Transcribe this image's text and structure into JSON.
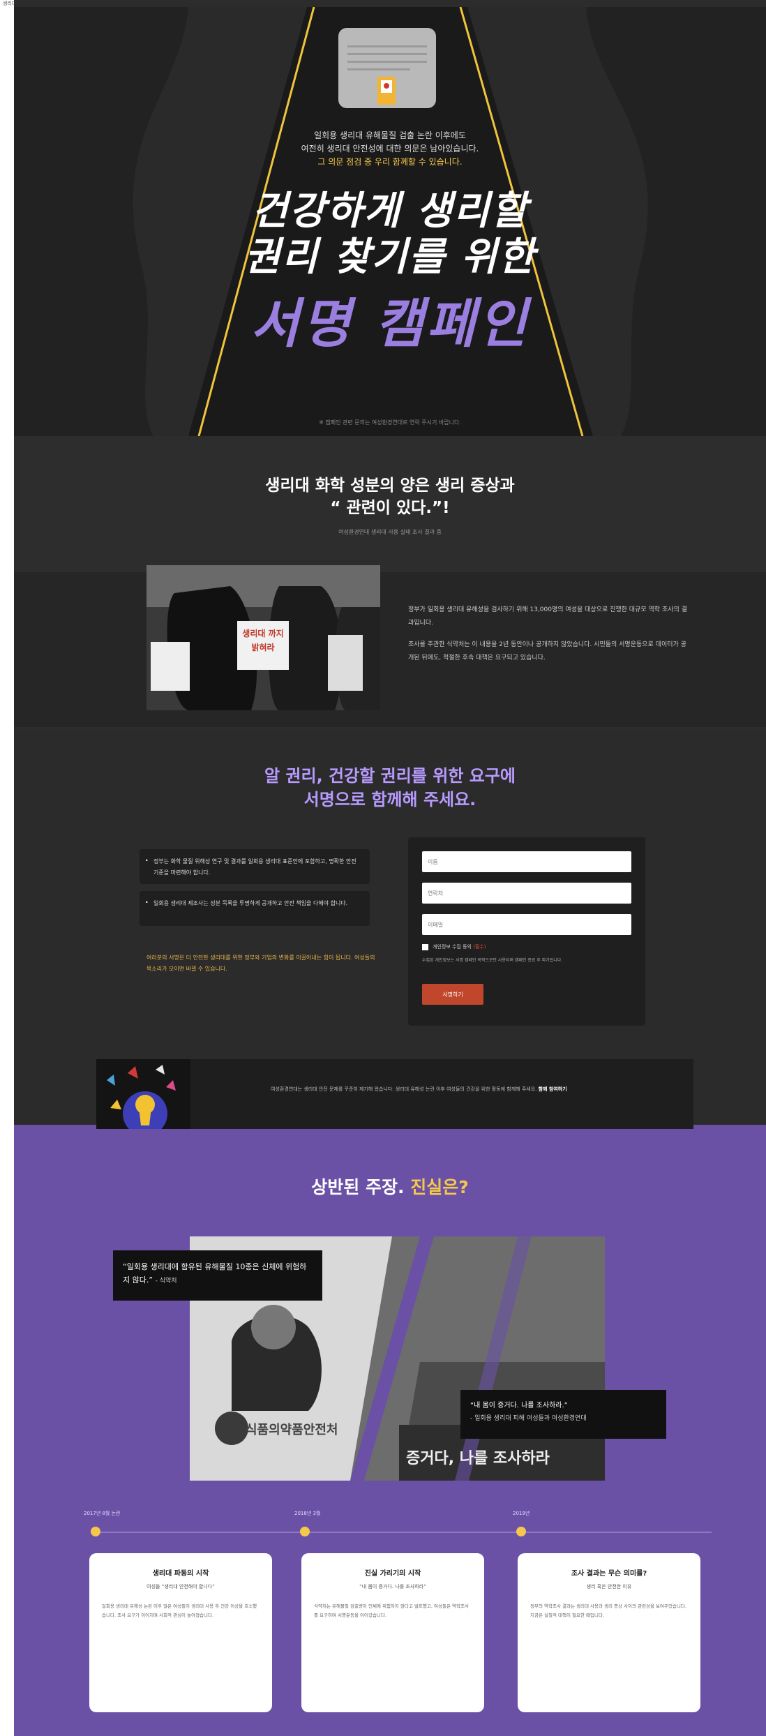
{
  "topbar": {
    "text": "생리대 화학물질 서명 캠페인"
  },
  "hero": {
    "line1": "일회용 생리대 유해물질 검출 논란 이후에도",
    "line2": "여전히 생리대 안전성에 대한 의문은 남아있습니다.",
    "line3": "그 의문 점검 중 우리 함께할 수 있습니다.",
    "title_line1": "건강하게 생리할",
    "title_line2": "권리 찾기를 위한",
    "title_big": "서명 캠페인",
    "footnote": "※ 캠페인 관련 문의는 여성환경연대로 연락 주시기 바랍니다."
  },
  "section2": {
    "title_line1": "생리대 화학 성분의 양은 생리 증상과",
    "title_line2": "“ 관련이 있다.”!",
    "subtitle": "여성환경연대 생리대 사용 실태 조사 결과 중",
    "photo_sign": "생리대 까지 밝혀라",
    "para1": "정부가 일회용 생리대 유해성을 검사하기 위해 13,000명의 여성을 대상으로 진행한 대규모 역학 조사의 결과입니다.",
    "para2": "조사를 주관한 식약처는 이 내용을 2년 동안이나 공개하지 않았습니다. 시민들의 서명운동으로 데이터가 공개된 뒤에도, 적절한 후속 대책은 요구되고 있습니다."
  },
  "section3": {
    "title_line1": "알 권리, 건강할 권리를 위한 요구에",
    "title_line2": "서명으로 함께해 주세요.",
    "bullet1": "정부는 화학 물질 위해성 연구 및 결과를 일회용 생리대 표준안에 포함하고, 명확한 안전 기준을 마련해야 합니다.",
    "bullet2": "일회용 생리대 제조사는 성분 목록을 투명하게 공개하고 안전 책임을 다해야 합니다.",
    "yellow_note": "여러분의 서명은 더 안전한 생리대를 위한 정부와 기업의 변화를 이끌어내는 힘이 됩니다. 여성들의 목소리가 모이면 바뀔 수 있습니다.",
    "form": {
      "name_placeholder": "이름",
      "phone_placeholder": "연락처",
      "email_placeholder": "이메일",
      "agree_label": "개인정보 수집 동의",
      "agree_required": "(필수)",
      "note": "수집된 개인정보는 서명 캠페인 목적으로만 사용되며 캠페인 종료 후 파기됩니다.",
      "submit": "서명하기"
    }
  },
  "banner": {
    "text": "여성환경연대는 생리대 안전 문제를 꾸준히 제기해 왔습니다. 생리대 유해성 논란 이후 여성들의 건강을 위한 활동에 함께해 주세요.",
    "bold": "함께 참여하기"
  },
  "section5": {
    "title_main": "상반된 주장. ",
    "title_highlight": "진실은?",
    "quote1": "“일회용 생리대에 함유된 유해물질 10종은 신체에 위험하지 않다.”",
    "quote1_src": "- 식약처",
    "quote2": "“내 몸이 증거다. 나를 조사하라.”",
    "quote2_src": "- 일회용 생리대 피해 여성들과 여성환경연대",
    "collage_sign": "식품의약품안전처",
    "collage_banner": "증거다, 나를 조사하라",
    "timeline": [
      {
        "label": "2017년 8월 논란",
        "title": "생리대 파동의 시작",
        "subtitle": "여성들 “생리대 안전해야 합니다”",
        "body": "일회용 생리대 유해성 논란 이후 많은 여성들이 생리대 사용 후 건강 이상을 호소했습니다. 조사 요구가 이어지며 사회적 관심이 높아졌습니다."
      },
      {
        "label": "2018년 3월",
        "title": "진실 가리기의 시작",
        "subtitle": "“내 몸이 증거다. 나를 조사하라”",
        "body": "식약처는 유해물질 검출량이 인체에 위험하지 않다고 발표했고, 여성들은 역학조사를 요구하며 서명운동을 이어갔습니다."
      },
      {
        "label": "2019년",
        "title": "조사 결과는 무슨 의미를?",
        "subtitle": "생리 혹은 안전한 이유",
        "body": "정부의 역학조사 결과는 생리대 사용과 생리 증상 사이의 관련성을 보여주었습니다. 지금은 실질적 대책이 필요한 때입니다."
      }
    ]
  }
}
